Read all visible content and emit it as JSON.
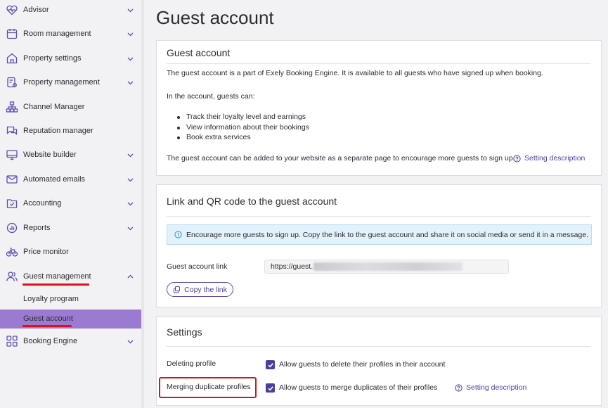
{
  "sidebar": {
    "items": [
      {
        "label": "Advisor",
        "icon": "heart-monitor-icon",
        "chevron": "down"
      },
      {
        "label": "Room management",
        "icon": "calendar-icon",
        "chevron": "down"
      },
      {
        "label": "Property settings",
        "icon": "home-icon",
        "chevron": "down"
      },
      {
        "label": "Property management",
        "icon": "clipboard-gear-icon",
        "chevron": "down"
      },
      {
        "label": "Channel Manager",
        "icon": "network-icon",
        "chevron": ""
      },
      {
        "label": "Reputation manager",
        "icon": "chat-bubbles-icon",
        "chevron": ""
      },
      {
        "label": "Website builder",
        "icon": "monitor-icon",
        "chevron": "down"
      },
      {
        "label": "Automated emails",
        "icon": "envelope-icon",
        "chevron": "down"
      },
      {
        "label": "Accounting",
        "icon": "folder-check-icon",
        "chevron": "down"
      },
      {
        "label": "Reports",
        "icon": "pie-chart-icon",
        "chevron": "down"
      },
      {
        "label": "Price monitor",
        "icon": "bicycle-icon",
        "chevron": ""
      },
      {
        "label": "Guest management",
        "icon": "users-icon",
        "chevron": "up"
      },
      {
        "label": "Booking Engine",
        "icon": "grid-icon",
        "chevron": "down"
      }
    ],
    "sub_items": [
      {
        "label": "Loyalty program"
      },
      {
        "label": "Guest account"
      }
    ]
  },
  "main": {
    "page_title": "Guest account",
    "guest_account_card": {
      "title": "Guest account",
      "intro": "The guest account is a part of Exely Booking Engine. It is available to all guests who have signed up when booking.",
      "list_intro": "In the account, guests can:",
      "bullets": [
        "Track their loyalty level and earnings",
        "View information about their bookings",
        "Book extra services"
      ],
      "footer": "The guest account can be added to your website as a separate page to encourage more guests to sign up.",
      "help_link": "Setting description"
    },
    "link_card": {
      "title": "Link and QR code to the guest account",
      "info": "Encourage more guests to sign up. Copy the link to the guest account and share it on social media or send it in a message.",
      "field_label": "Guest account link",
      "field_value": "https://guest.",
      "copy_button": "Copy the link"
    },
    "settings_card": {
      "title": "Settings",
      "deleting_label": "Deleting profile",
      "deleting_checkbox": "Allow guests to delete their profiles in their account",
      "merging_label": "Merging duplicate profiles",
      "merging_checkbox": "Allow guests to merge duplicates of their profiles",
      "help_link": "Setting description"
    }
  },
  "colors": {
    "accent": "#4a3fa0",
    "active_item": "#9b7bd1",
    "highlight": "#e0101a",
    "info_bg": "#e3f2fa"
  }
}
